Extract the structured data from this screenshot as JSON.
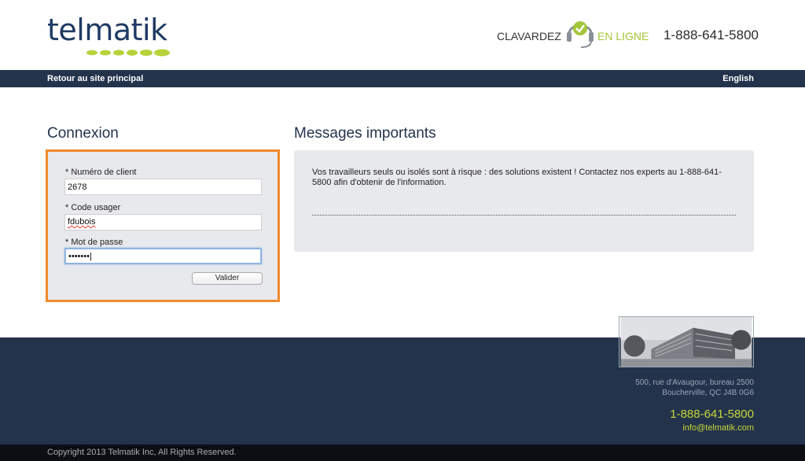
{
  "header": {
    "logo_text": "telmatik",
    "chat_label": "CLAVARDEZ",
    "online_label": "EN LIGNE",
    "phone": "1-888-641-5800",
    "icons": {
      "headset": "headset-check-icon"
    },
    "colors": {
      "brand_navy": "#24334c",
      "brand_green": "#a3c638"
    }
  },
  "nav": {
    "back_link": "Retour au site principal",
    "language_link": "English"
  },
  "login": {
    "title": "Connexion",
    "client_number": {
      "label": "* Numéro de client",
      "value": "2678"
    },
    "user_code": {
      "label": "* Code usager",
      "value": "fdubois"
    },
    "password": {
      "label": "* Mot de passe",
      "value": "•••••••"
    },
    "submit_label": "Valider",
    "highlight_color": "#f08a2c"
  },
  "messages": {
    "title": "Messages importants",
    "body": "Vos travailleurs seuls ou isolés sont à risque : des solutions existent ! Contactez nos experts au 1-888-641-5800 afin d'obtenir de l'information."
  },
  "footer": {
    "address_line1": "500, rue d'Avaugour, bureau 2500",
    "address_line2": "Boucherville, QC J4B 0G6",
    "phone": "1-888-641-5800",
    "email": "info@telmatik.com",
    "copyright": "Copyright 2013 Telmatik Inc, All Rights Reserved."
  }
}
